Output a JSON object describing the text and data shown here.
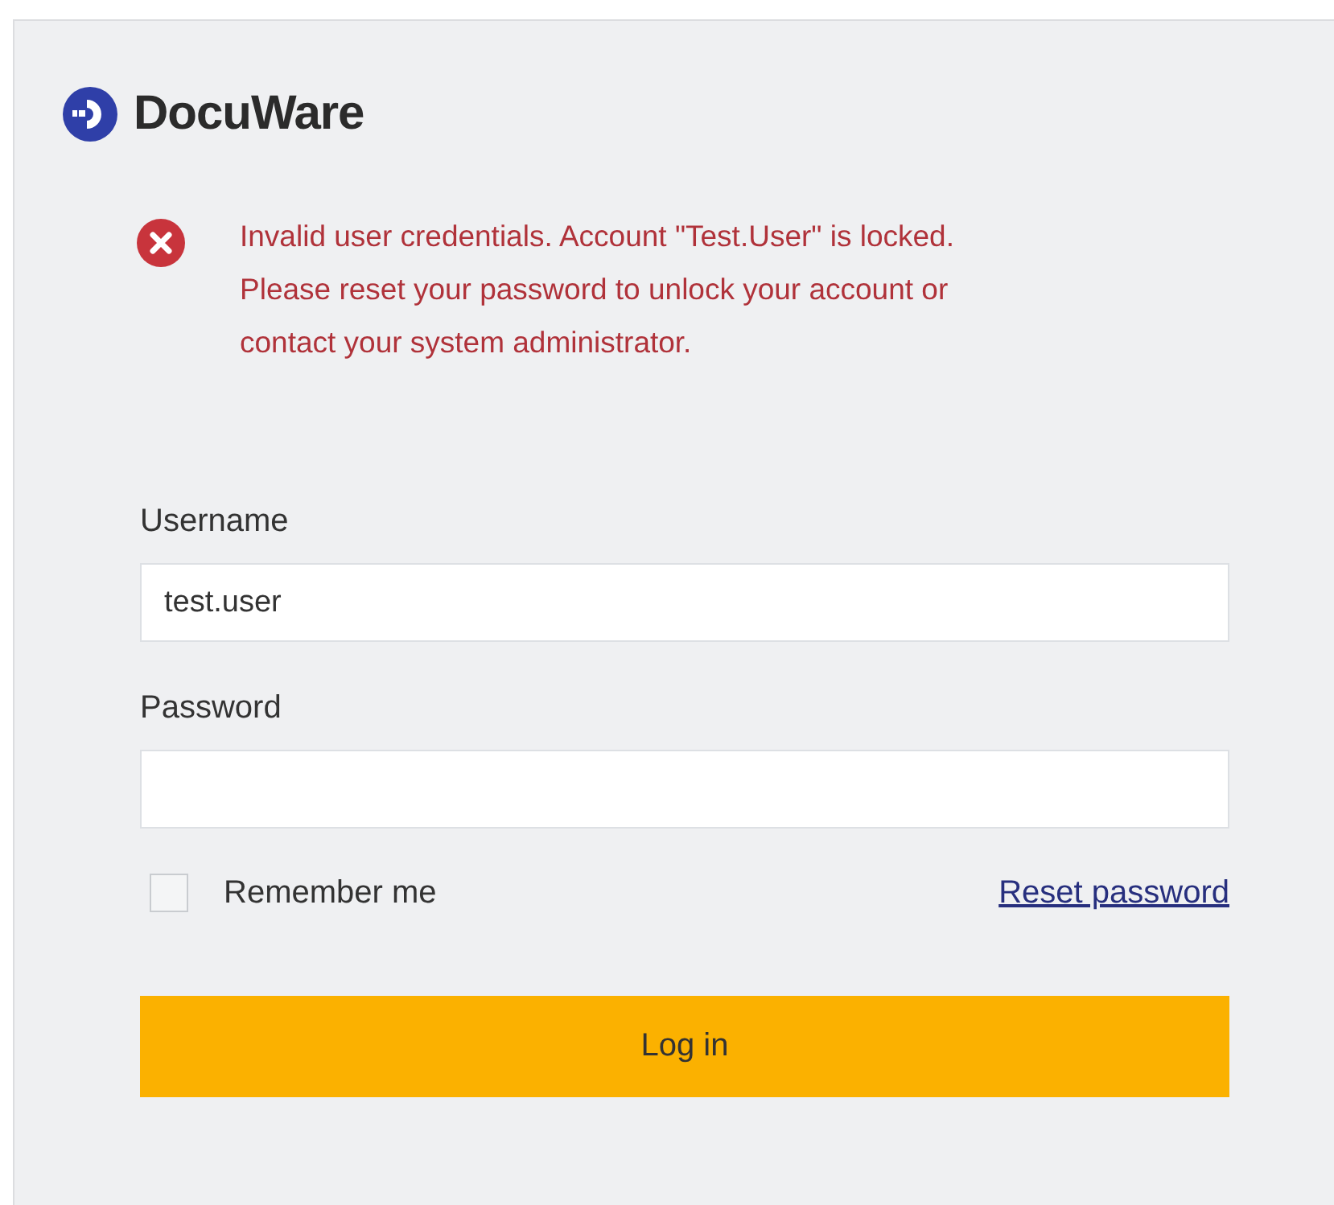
{
  "logo": {
    "text": "DocuWare"
  },
  "error": {
    "message": "Invalid user credentials. Account \"Test.User\" is locked. Please reset your password to unlock your account or contact your system administrator."
  },
  "fields": [
    {
      "label": "Username",
      "value": "test.user",
      "kind": "text"
    },
    {
      "label": "Password",
      "kind": "password"
    }
  ],
  "remember": {
    "label": "Remember me",
    "checked": false
  },
  "reset_link": "Reset password",
  "login_button": "Log in"
}
